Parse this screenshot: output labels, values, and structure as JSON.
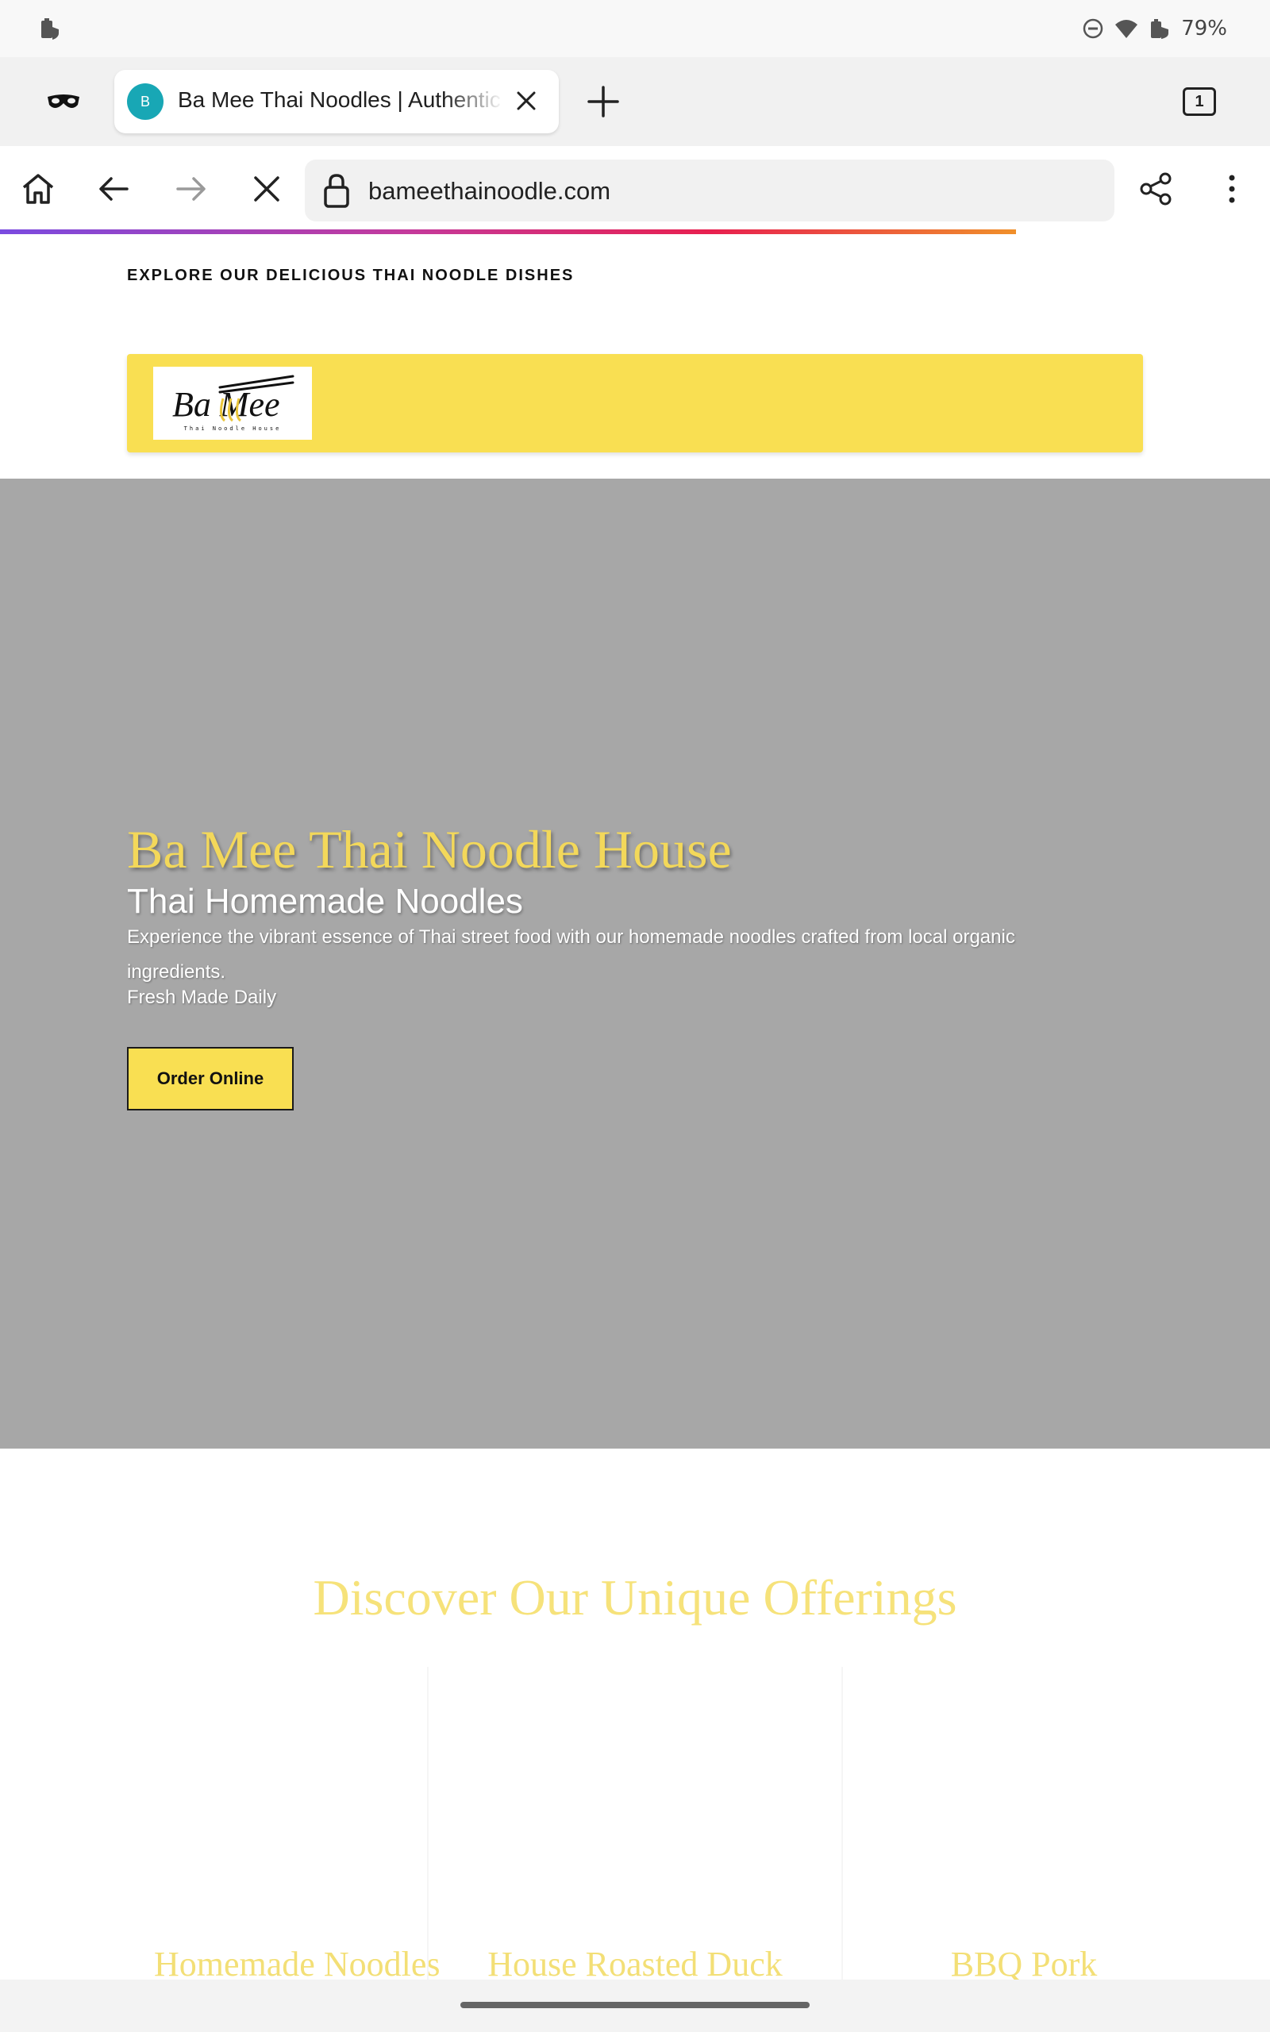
{
  "status_bar": {
    "battery": "79%"
  },
  "browser": {
    "tab": {
      "favicon_letter": "B",
      "title": "Ba Mee Thai Noodles | Authentic",
      "favicon_color": "#18a7b5"
    },
    "tab_count": "1",
    "url": "bameethainoodle.com",
    "icons": [
      "incognito-icon",
      "close-icon",
      "plus-icon",
      "home-icon",
      "back-arrow-icon",
      "forward-arrow-icon",
      "stop-icon",
      "lock-icon",
      "share-icon",
      "more-vert-icon"
    ]
  },
  "page": {
    "tagline": "EXPLORE OUR DELICIOUS THAI NOODLE DISHES",
    "logo": {
      "main": "Ba Mee",
      "sub": "Thai Noodle House"
    },
    "hero": {
      "title": "Ba Mee Thai Noodle House",
      "subtitle": "Thai Homemade Noodles",
      "description": "Experience the vibrant essence of Thai street food with our homemade noodles crafted from local organic ingredients.",
      "fresh": "Fresh Made Daily",
      "cta": "Order Online"
    },
    "offerings": {
      "title": "Discover Our Unique Offerings",
      "items": [
        {
          "label": "Homemade Noodles"
        },
        {
          "label": "House Roasted Duck"
        },
        {
          "label": "BBQ Pork"
        }
      ]
    },
    "colors": {
      "accent_yellow": "#f9df52",
      "hero_bg": "#a7a7a7"
    }
  }
}
